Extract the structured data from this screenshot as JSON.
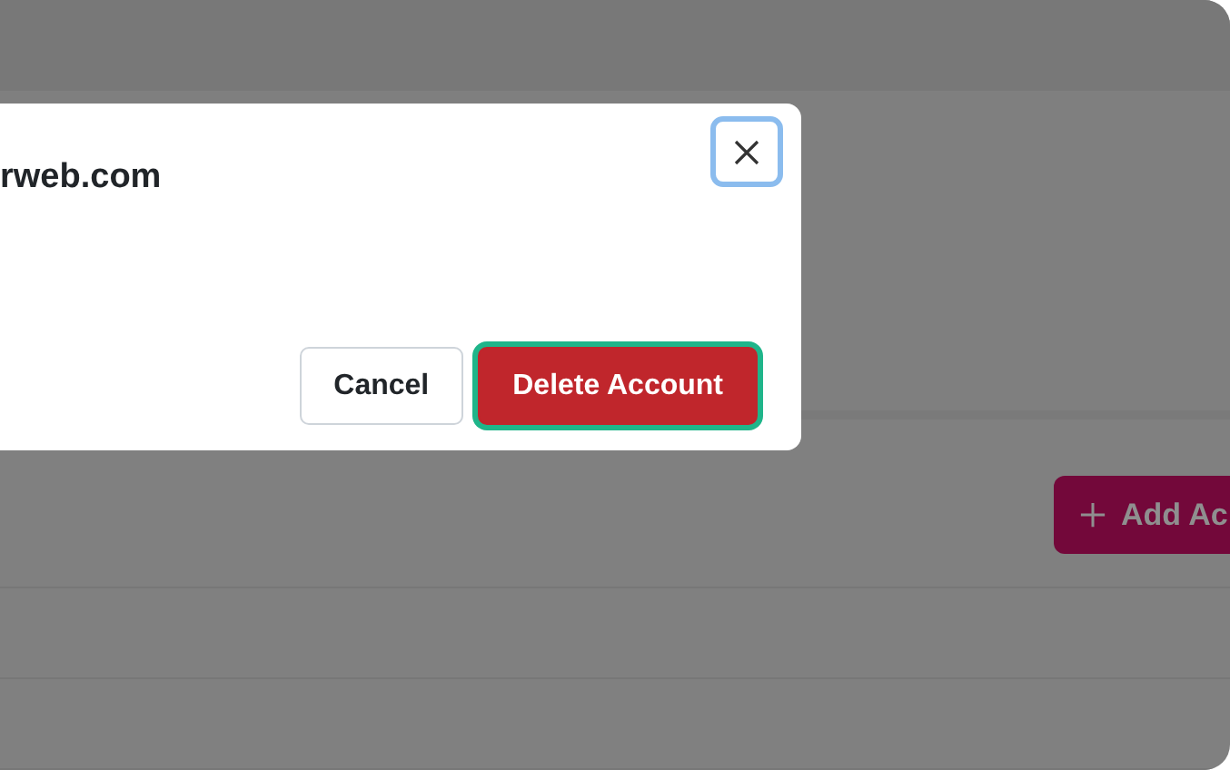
{
  "modal": {
    "title": "rweb.com",
    "buttons": [
      {
        "label": "Cancel",
        "kind": "secondary",
        "focused": false
      },
      {
        "label": "Delete Account",
        "kind": "danger",
        "focused": true
      }
    ]
  },
  "toolbar": {
    "add_button": "Add Ac"
  }
}
